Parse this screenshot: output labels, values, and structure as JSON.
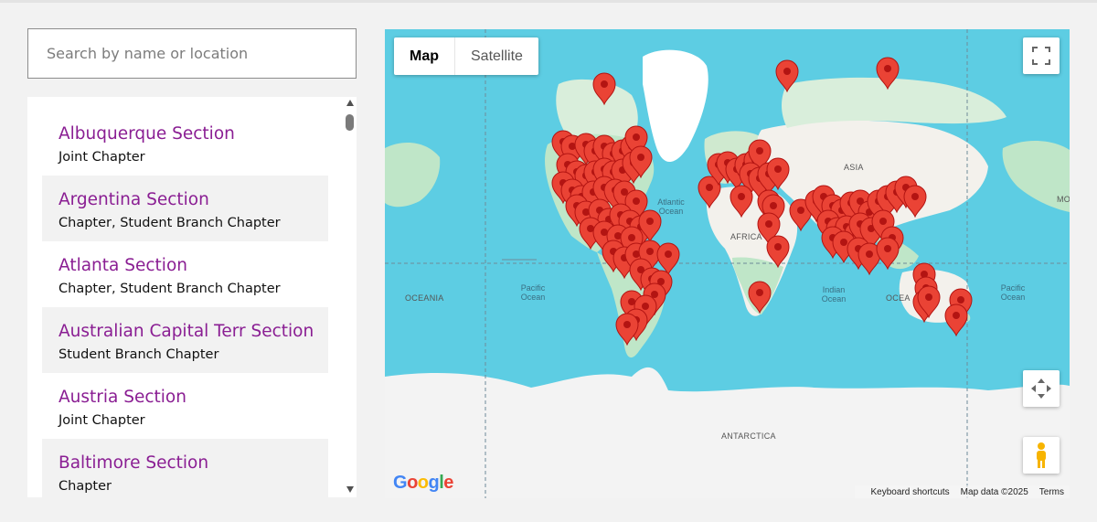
{
  "search": {
    "placeholder": "Search by name or location"
  },
  "list": [
    {
      "name": "Albuquerque Section",
      "type": "Joint Chapter"
    },
    {
      "name": "Argentina Section",
      "type": "Chapter, Student Branch Chapter"
    },
    {
      "name": "Atlanta Section",
      "type": "Chapter, Student Branch Chapter"
    },
    {
      "name": "Australian Capital Terr Section",
      "type": "Student Branch Chapter"
    },
    {
      "name": "Austria Section",
      "type": "Joint Chapter"
    },
    {
      "name": "Baltimore Section",
      "type": "Chapter"
    }
  ],
  "map": {
    "tabs": {
      "map": "Map",
      "satellite": "Satellite"
    },
    "labels": {
      "asia": "ASIA",
      "africa": "AFRICA",
      "oceania": "OCEANIA",
      "oceania_clip": "OCEA",
      "antarctica": "ANTARCTICA",
      "atlantic": "Atlantic\nOcean",
      "pacific": "Pacific\nOcean",
      "indian": "Indian\nOcean",
      "mo": "MO"
    },
    "footer": {
      "shortcuts": "Keyboard shortcuts",
      "mapdata": "Map data ©2025",
      "terms": "Terms"
    },
    "logo": "Google",
    "colors": {
      "water": "#5dcde3",
      "land": "#f3f1ec",
      "green": "#bfe6c8",
      "pin": "#ea4335",
      "brand_text": "#8a1e93"
    }
  }
}
